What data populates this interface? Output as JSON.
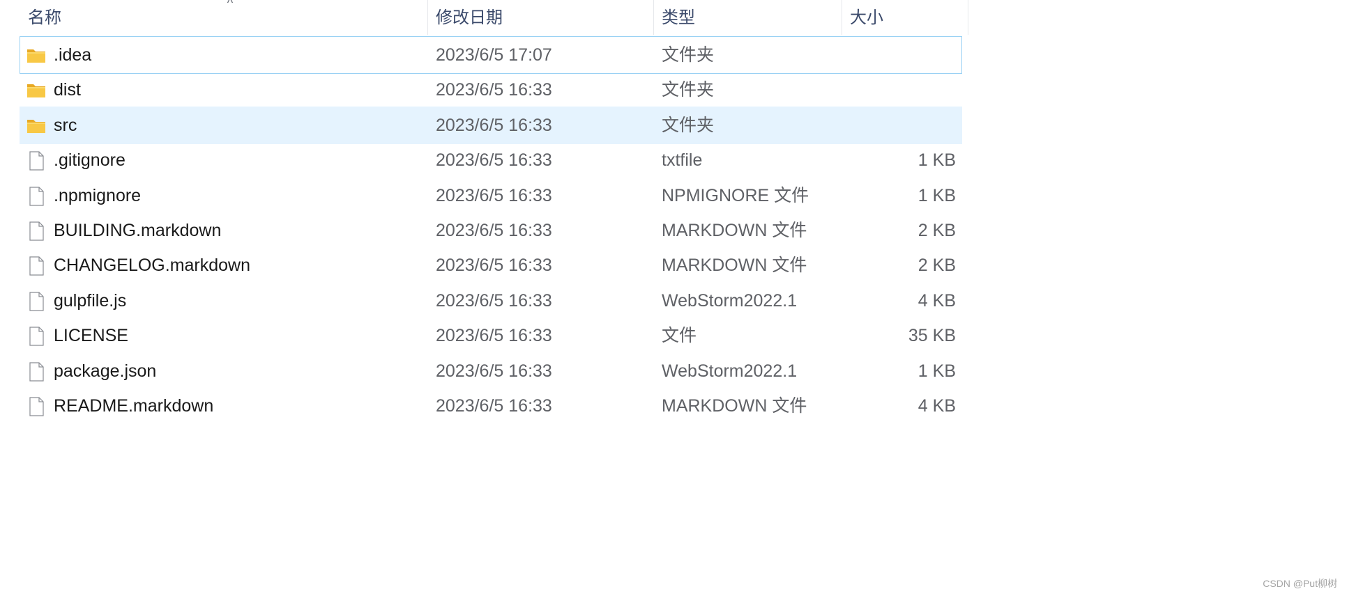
{
  "header": {
    "name": "名称",
    "date": "修改日期",
    "type": "类型",
    "size": "大小",
    "sort_indicator": "^"
  },
  "rows": [
    {
      "name": ".idea",
      "date": "2023/6/5 17:07",
      "type": "文件夹",
      "size": "",
      "icon": "folder-icon",
      "state": "focused"
    },
    {
      "name": "dist",
      "date": "2023/6/5 16:33",
      "type": "文件夹",
      "size": "",
      "icon": "folder-icon",
      "state": ""
    },
    {
      "name": "src",
      "date": "2023/6/5 16:33",
      "type": "文件夹",
      "size": "",
      "icon": "folder-icon",
      "state": "selected"
    },
    {
      "name": ".gitignore",
      "date": "2023/6/5 16:33",
      "type": "txtfile",
      "size": "1 KB",
      "icon": "file-icon",
      "state": ""
    },
    {
      "name": ".npmignore",
      "date": "2023/6/5 16:33",
      "type": "NPMIGNORE 文件",
      "size": "1 KB",
      "icon": "file-icon",
      "state": ""
    },
    {
      "name": "BUILDING.markdown",
      "date": "2023/6/5 16:33",
      "type": "MARKDOWN 文件",
      "size": "2 KB",
      "icon": "file-icon",
      "state": ""
    },
    {
      "name": "CHANGELOG.markdown",
      "date": "2023/6/5 16:33",
      "type": "MARKDOWN 文件",
      "size": "2 KB",
      "icon": "file-icon",
      "state": ""
    },
    {
      "name": "gulpfile.js",
      "date": "2023/6/5 16:33",
      "type": "WebStorm2022.1",
      "size": "4 KB",
      "icon": "file-icon",
      "state": ""
    },
    {
      "name": "LICENSE",
      "date": "2023/6/5 16:33",
      "type": "文件",
      "size": "35 KB",
      "icon": "file-icon",
      "state": ""
    },
    {
      "name": "package.json",
      "date": "2023/6/5 16:33",
      "type": "WebStorm2022.1",
      "size": "1 KB",
      "icon": "file-icon",
      "state": ""
    },
    {
      "name": "README.markdown",
      "date": "2023/6/5 16:33",
      "type": "MARKDOWN 文件",
      "size": "4 KB",
      "icon": "file-icon",
      "state": ""
    }
  ],
  "watermark": "CSDN @Put柳树",
  "colors": {
    "selection_bg": "#e5f3fe",
    "focus_border": "#99d1f4",
    "folder": "#f8c845"
  }
}
